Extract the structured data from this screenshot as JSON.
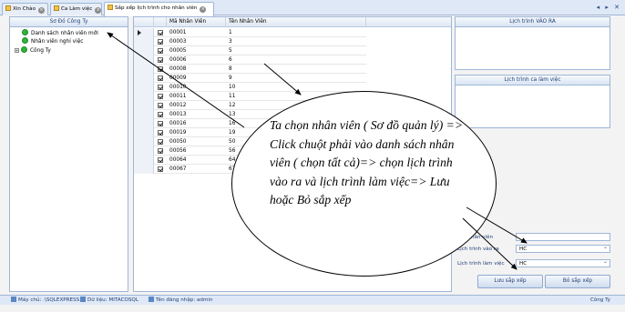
{
  "tabs": [
    {
      "label": "Xin Chào",
      "active": false
    },
    {
      "label": "Ca Làm việc",
      "active": false
    },
    {
      "label": "Sắp xếp lịch trình cho nhân viên",
      "active": true
    }
  ],
  "window_controls": "◂ ▸ ✕",
  "left_panel": {
    "title": "Sơ Đồ Công Ty",
    "items": [
      "Danh sách nhân viên mới",
      "Nhân viên nghỉ việc",
      "Công Ty"
    ]
  },
  "grid": {
    "columns": [
      "Mã Nhân Viên",
      "Tên Nhân Viên"
    ],
    "rows": [
      [
        "00001",
        "1"
      ],
      [
        "00003",
        "3"
      ],
      [
        "00005",
        "5"
      ],
      [
        "00006",
        "6"
      ],
      [
        "00008",
        "8"
      ],
      [
        "00009",
        "9"
      ],
      [
        "00010",
        "10"
      ],
      [
        "00011",
        "11"
      ],
      [
        "00012",
        "12"
      ],
      [
        "00013",
        "13"
      ],
      [
        "00016",
        "16"
      ],
      [
        "00019",
        "19"
      ],
      [
        "00050",
        "50"
      ],
      [
        "00056",
        "56"
      ],
      [
        "00064",
        "64"
      ],
      [
        "00067",
        "67"
      ]
    ]
  },
  "right_panel": {
    "schedule_in_out_title": "Lịch trình VÀO RA",
    "shift_schedule_title": "Lịch trình ca làm việc",
    "employee_name_label": "Tên nhân viên",
    "employee_name_value": "",
    "in_out_label": "Lịch trình vào ra",
    "in_out_value": "HC",
    "work_label": "Lịch trình làm việc",
    "work_value": "HC",
    "save_button": "Lưu sắp xếp",
    "cancel_button": "Bỏ sắp xếp"
  },
  "status_bar": {
    "server": "Máy chủ: .\\SQLEXPRESS",
    "database": "Dữ liệu: MITACOSQL",
    "login": "Tên đăng nhập: admin",
    "company": "Công Ty"
  },
  "annotation": "Ta chọn nhân viên ( Sơ đồ quản lý) => Click chuột phải vào danh sách nhân viên ( chọn tất cả)=> chọn lịch trình vào ra và lịch trình làm việc=> Lưu hoặc Bỏ sắp xếp",
  "colors": {
    "accent": "#1f3f75",
    "panel_border": "#9eb6d6",
    "status_dot": "#2fb33a"
  }
}
